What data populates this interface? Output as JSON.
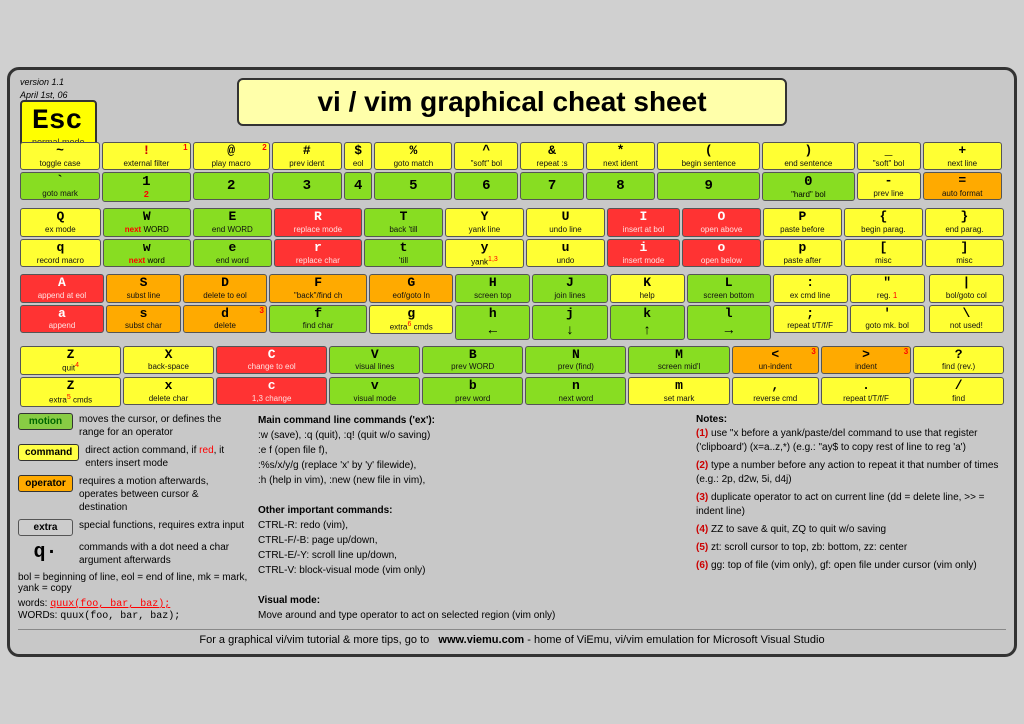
{
  "meta": {
    "version": "version 1.1",
    "date": "April 1st, 06"
  },
  "title": "vi / vim graphical cheat sheet",
  "esc": {
    "label": "Esc",
    "sublabel": "normal mode"
  },
  "footer": {
    "text": "For a graphical vi/vim tutorial & more tips, go to",
    "url": "www.viemu.com",
    "suffix": " - home of ViEmu, vi/vim emulation for Microsoft Visual Studio"
  },
  "notes_title": "Notes:",
  "notes": [
    {
      "num": "(1)",
      "text": "use \"x before a yank/paste/del command to use that register ('clipboard') (x=a..z,*) (e.g.: \"ay$ to copy rest of line to reg 'a')"
    },
    {
      "num": "(2)",
      "text": "type a number before any action to repeat it that number of times (e.g.: 2p, d2w, 5i, d4j)"
    },
    {
      "num": "(3)",
      "text": "duplicate operator to act on current line (dd = delete line, >> = indent line)"
    },
    {
      "num": "(4)",
      "text": "ZZ to save & quit, ZQ to quit w/o saving"
    },
    {
      "num": "(5)",
      "text": "zt: scroll cursor to top, zb: bottom, zz: center"
    },
    {
      "num": "(6)",
      "text": "gg: top of file (vim only), gf: open file under cursor (vim only)"
    }
  ],
  "main_commands_title": "Main command line commands ('ex'):",
  "main_commands": [
    ":w (save), :q (quit), :q! (quit w/o saving)",
    ":e f (open file f),",
    ":%s/x/y/g (replace 'x' by 'y' filewide),",
    ":h (help in vim), :new (new file in vim),"
  ],
  "other_commands_title": "Other important commands:",
  "other_commands": [
    "CTRL-R: redo (vim),",
    "CTRL-F/-B: page up/down,",
    "CTRL-E/-Y: scroll line up/down,",
    "CTRL-V: block-visual mode (vim only)"
  ],
  "visual_mode_title": "Visual mode:",
  "visual_mode": "Move around and type operator to act on selected region (vim only)",
  "legend": [
    {
      "badge": "motion",
      "badge_class": "badge-green",
      "desc": "moves the cursor, or defines the range for an operator"
    },
    {
      "badge": "command",
      "badge_class": "badge-yellow",
      "desc": "direct action command, if red, it enters insert mode"
    },
    {
      "badge": "operator",
      "badge_class": "badge-orange",
      "desc": "requires a motion afterwards, operates between cursor & destination"
    },
    {
      "badge": "extra",
      "badge_class": "badge-gray",
      "desc": "special functions, requires extra input"
    }
  ],
  "bol_text": "bol = beginning of line, eol = end of line, mk = mark, yank = copy",
  "words_label": "words:",
  "words_example": "quux(foo, bar, baz);",
  "WORDS_label": "WORDs:",
  "WORDS_example": "quux(foo, bar, baz);"
}
